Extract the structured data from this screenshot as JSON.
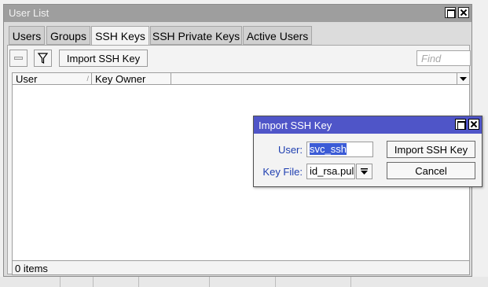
{
  "window": {
    "title": "User List",
    "tabs": [
      {
        "label": "Users"
      },
      {
        "label": "Groups"
      },
      {
        "label": "SSH Keys"
      },
      {
        "label": "SSH Private Keys"
      },
      {
        "label": "Active Users"
      }
    ],
    "active_tab": "SSH Keys",
    "toolbar": {
      "import_label": "Import SSH Key",
      "find_placeholder": "Find",
      "remove_icon": "remove-icon",
      "filter_icon": "filter-icon"
    },
    "table": {
      "columns": [
        "User",
        "Key Owner"
      ],
      "rows": []
    },
    "status": "0 items"
  },
  "dialog": {
    "title": "Import SSH Key",
    "user_label": "User:",
    "user_value": "svc_ssh",
    "keyfile_label": "Key File:",
    "keyfile_value": "id_rsa.pul",
    "import_button": "Import SSH Key",
    "cancel_button": "Cancel"
  },
  "colors": {
    "dialog_title_bg": "#4f55c8",
    "label_blue": "#1f3fb0",
    "selection": "#3b5bd6"
  }
}
